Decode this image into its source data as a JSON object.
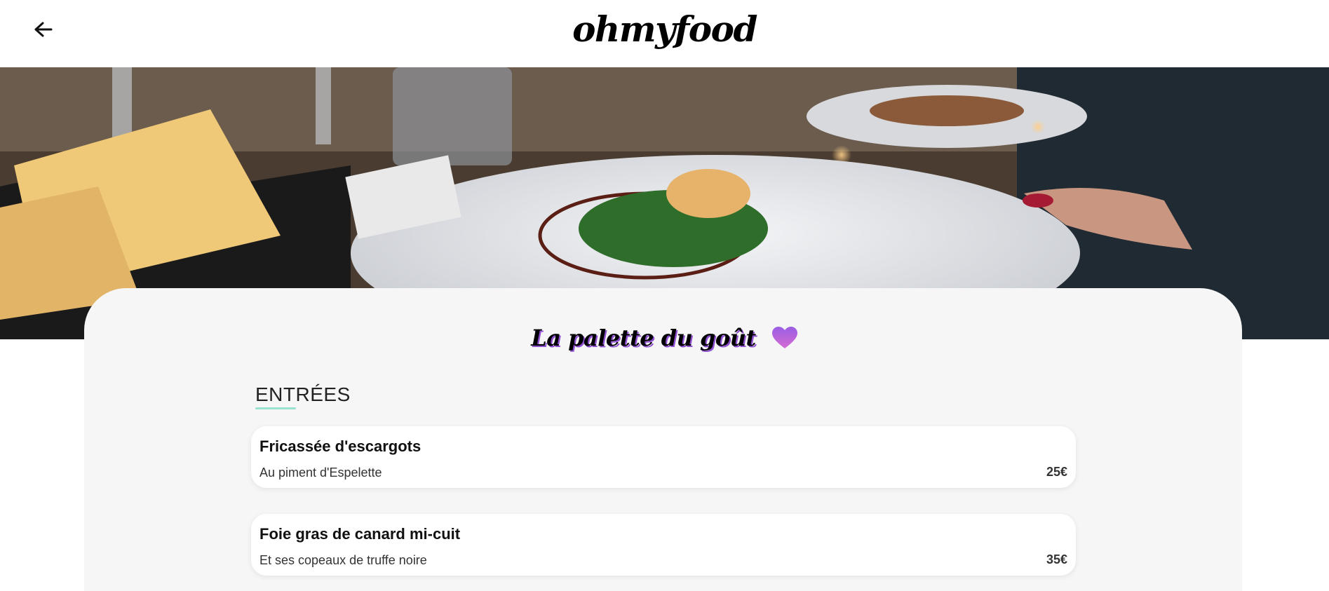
{
  "header": {
    "logo_text": "ohmyfood",
    "back_icon": "arrow-left-icon"
  },
  "hero": {
    "image_subject": "plated dish on a restaurant table"
  },
  "restaurant": {
    "title": "La palette du goût",
    "favorite_icon": "heart-icon"
  },
  "menu": {
    "section_title": "ENTRÉES",
    "dishes": [
      {
        "name": "Fricassée d'escargots",
        "description": "Au piment d'Espelette",
        "price": "25€"
      },
      {
        "name": "Foie gras de canard mi-cuit",
        "description": "Et ses copeaux de truffe noire",
        "price": "35€"
      }
    ]
  },
  "colors": {
    "accent_underline": "#99e2d0",
    "heart_gradient_start": "#d56bd3",
    "heart_gradient_end": "#9a5ee3",
    "card_background": "#f6f6f6"
  }
}
